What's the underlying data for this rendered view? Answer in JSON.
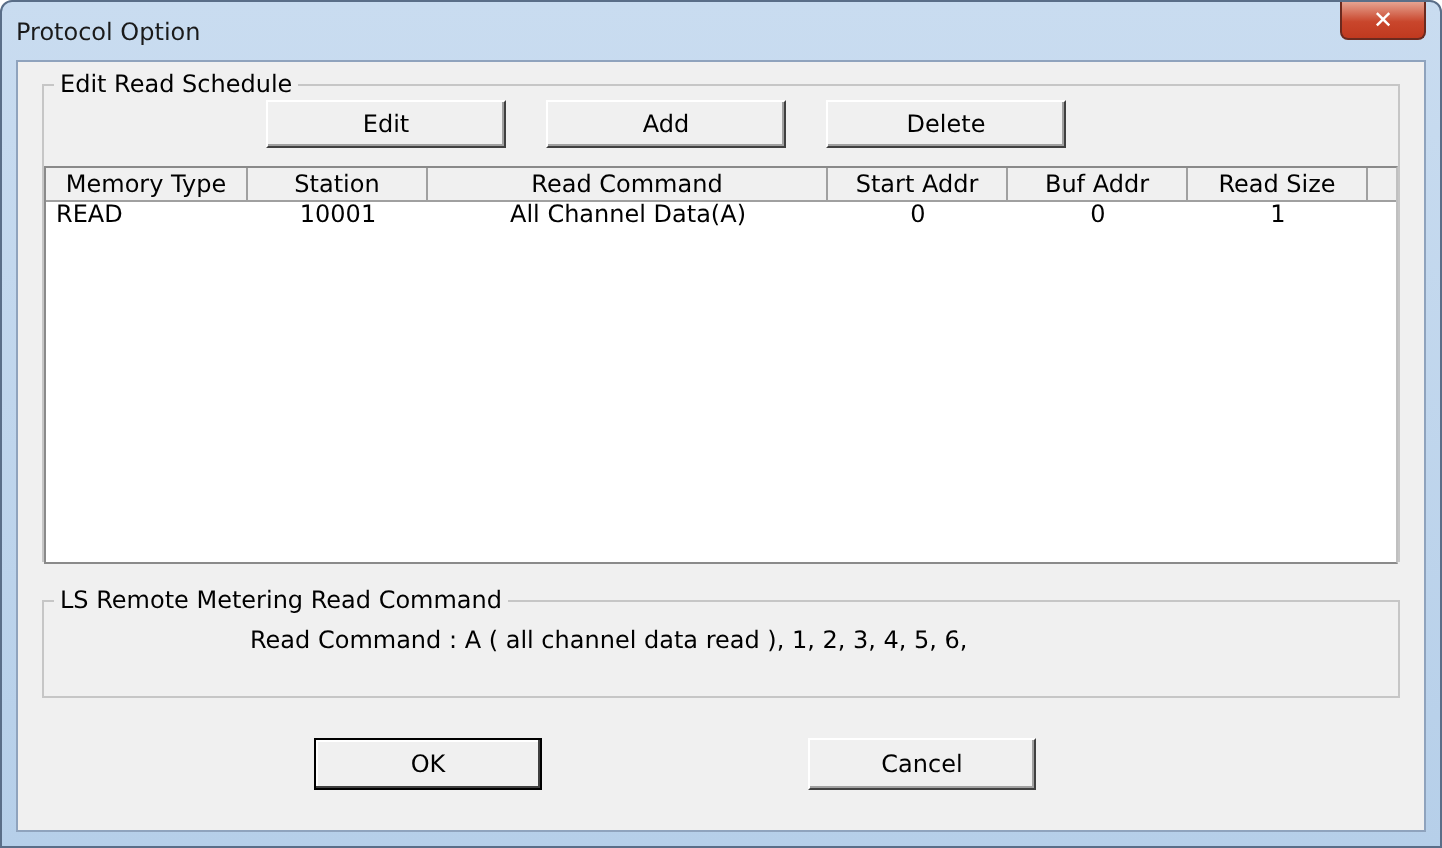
{
  "window": {
    "title": "Protocol Option",
    "close": "✕"
  },
  "schedule": {
    "title": "Edit Read Schedule",
    "buttons": [
      "Edit",
      "Add",
      "Delete"
    ],
    "columns": [
      "Memory Type",
      "Station",
      "Read Command",
      "Start Addr",
      "Buf Addr",
      "Read Size"
    ],
    "rows": [
      [
        "READ",
        "10001",
        "All Channel Data(A)",
        "0",
        "0",
        "1"
      ]
    ]
  },
  "ls": {
    "title": "LS Remote Metering Read Command",
    "text": "Read Command : A ( all channel data read ), 1, 2, 3, 4, 5, 6,"
  },
  "buttons": [
    {
      "label": "OK",
      "kind": "default"
    },
    {
      "label": "Cancel",
      "kind": "normal"
    }
  ]
}
